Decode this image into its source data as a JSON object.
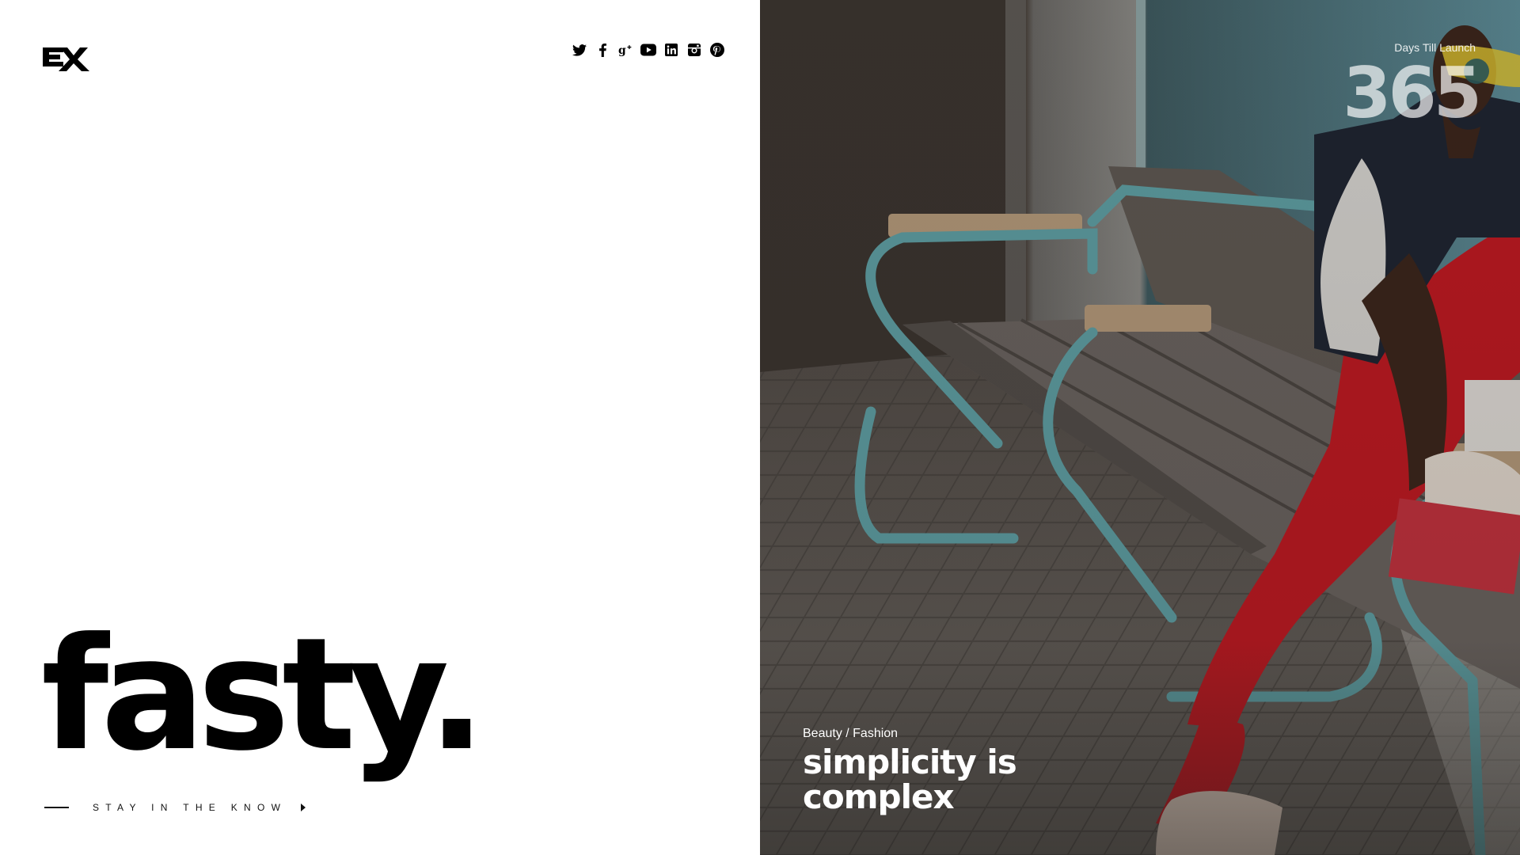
{
  "brand": {
    "logo_text": "EX",
    "name": "fasty."
  },
  "social": [
    {
      "icon": "twitter-icon"
    },
    {
      "icon": "facebook-icon"
    },
    {
      "icon": "google-plus-icon"
    },
    {
      "icon": "youtube-icon"
    },
    {
      "icon": "linkedin-icon"
    },
    {
      "icon": "instagram-icon"
    },
    {
      "icon": "pinterest-icon"
    }
  ],
  "newsletter": {
    "label": "Stay in the know"
  },
  "countdown": {
    "label": "Days Till Launch",
    "value": "365"
  },
  "feature": {
    "category": "Beauty / Fashion",
    "headline": "simplicity is complex"
  },
  "colors": {
    "text": "#000000",
    "background": "#ffffff",
    "photo_overlay": "#1e1c1a",
    "bench_frame": "#5fa3a8",
    "pants": "#c4161f"
  }
}
